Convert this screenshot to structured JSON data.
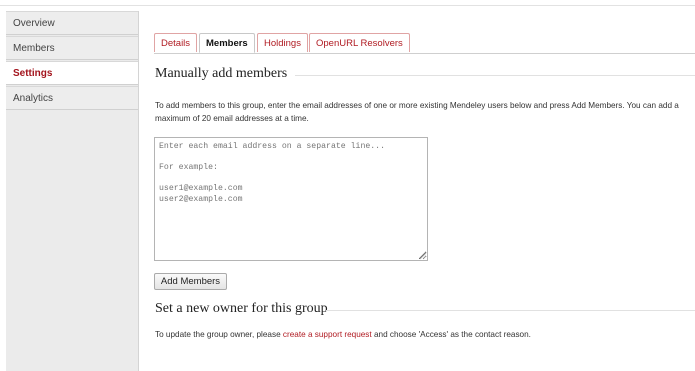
{
  "sidebar": {
    "items": [
      {
        "label": "Overview"
      },
      {
        "label": "Members"
      },
      {
        "label": "Settings",
        "active": true
      },
      {
        "label": "Analytics"
      }
    ]
  },
  "tabs": [
    {
      "label": "Details"
    },
    {
      "label": "Members",
      "active": true
    },
    {
      "label": "Holdings"
    },
    {
      "label": "OpenURL Resolvers"
    }
  ],
  "add_members": {
    "title": "Manually add members",
    "description": "To add members to this group, enter the email addresses of one or more existing Mendeley users below and press Add Members. You can add a maximum of 20 email addresses at a time.",
    "placeholder": "Enter each email address on a separate line...\n\nFor example:\n\nuser1@example.com\nuser2@example.com",
    "button_label": "Add Members"
  },
  "owner": {
    "title": "Set a new owner for this group",
    "text_before": "To update the group owner, please ",
    "link_text": "create a support request",
    "text_after": " and choose 'Access' as the contact reason."
  },
  "colors": {
    "accent": "#a3141d",
    "link": "#b01b22",
    "sidebar_bg": "#ebebeb"
  }
}
